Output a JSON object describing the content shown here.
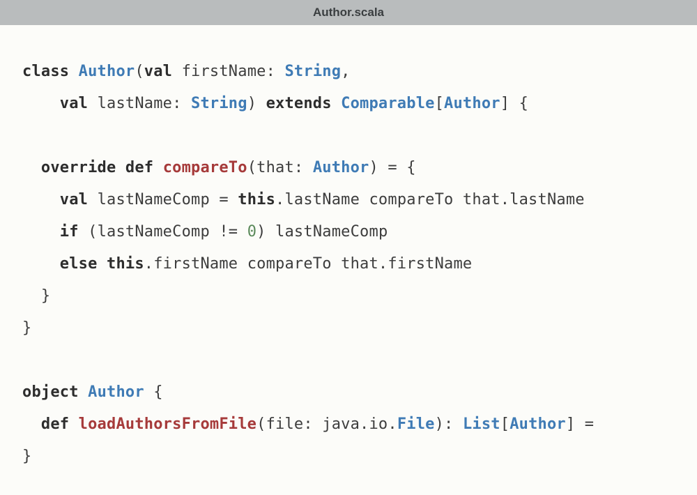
{
  "titlebar": {
    "filename": "Author.scala"
  },
  "code": {
    "tokens": [
      [
        {
          "t": "class ",
          "c": "kw"
        },
        {
          "t": "Author",
          "c": "type"
        },
        {
          "t": "(",
          "c": ""
        },
        {
          "t": "val ",
          "c": "kw"
        },
        {
          "t": "firstName: ",
          "c": ""
        },
        {
          "t": "String",
          "c": "type"
        },
        {
          "t": ",",
          "c": ""
        }
      ],
      [
        {
          "t": "    ",
          "c": ""
        },
        {
          "t": "val ",
          "c": "kw"
        },
        {
          "t": "lastName: ",
          "c": ""
        },
        {
          "t": "String",
          "c": "type"
        },
        {
          "t": ") ",
          "c": ""
        },
        {
          "t": "extends ",
          "c": "kw"
        },
        {
          "t": "Comparable",
          "c": "type"
        },
        {
          "t": "[",
          "c": ""
        },
        {
          "t": "Author",
          "c": "type"
        },
        {
          "t": "] {",
          "c": ""
        }
      ],
      [],
      [
        {
          "t": "  ",
          "c": ""
        },
        {
          "t": "override def ",
          "c": "kw"
        },
        {
          "t": "compareTo",
          "c": "method"
        },
        {
          "t": "(that: ",
          "c": ""
        },
        {
          "t": "Author",
          "c": "type"
        },
        {
          "t": ") = {",
          "c": ""
        }
      ],
      [
        {
          "t": "    ",
          "c": ""
        },
        {
          "t": "val ",
          "c": "kw"
        },
        {
          "t": "lastNameComp = ",
          "c": ""
        },
        {
          "t": "this",
          "c": "kw"
        },
        {
          "t": ".lastName compareTo that.lastName",
          "c": ""
        }
      ],
      [
        {
          "t": "    ",
          "c": ""
        },
        {
          "t": "if ",
          "c": "kw"
        },
        {
          "t": "(lastNameComp != ",
          "c": ""
        },
        {
          "t": "0",
          "c": "num"
        },
        {
          "t": ") lastNameComp",
          "c": ""
        }
      ],
      [
        {
          "t": "    ",
          "c": ""
        },
        {
          "t": "else ",
          "c": "kw"
        },
        {
          "t": "this",
          "c": "kw"
        },
        {
          "t": ".firstName compareTo that.firstName",
          "c": ""
        }
      ],
      [
        {
          "t": "  }",
          "c": ""
        }
      ],
      [
        {
          "t": "}",
          "c": ""
        }
      ],
      [],
      [
        {
          "t": "object ",
          "c": "kw"
        },
        {
          "t": "Author",
          "c": "type"
        },
        {
          "t": " {",
          "c": ""
        }
      ],
      [
        {
          "t": "  ",
          "c": ""
        },
        {
          "t": "def ",
          "c": "kw"
        },
        {
          "t": "loadAuthorsFromFile",
          "c": "method"
        },
        {
          "t": "(file: java.io.",
          "c": ""
        },
        {
          "t": "File",
          "c": "type"
        },
        {
          "t": "): ",
          "c": ""
        },
        {
          "t": "List",
          "c": "type"
        },
        {
          "t": "[",
          "c": ""
        },
        {
          "t": "Author",
          "c": "type"
        },
        {
          "t": "] =",
          "c": ""
        }
      ],
      [
        {
          "t": "}",
          "c": ""
        }
      ]
    ]
  }
}
